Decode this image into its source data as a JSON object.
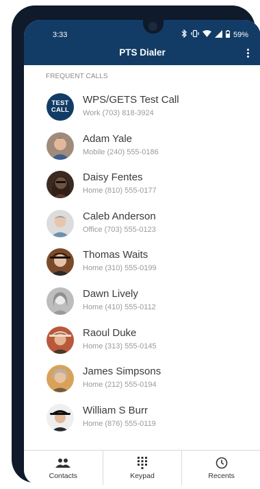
{
  "status_bar": {
    "time": "3:33",
    "battery": "59%"
  },
  "app": {
    "title": "PTS Dialer"
  },
  "section": {
    "header": "FREQUENT CALLS"
  },
  "contacts": [
    {
      "name": "WPS/GETS Test Call",
      "detail": "Work (703) 818-3924",
      "avatar_text_1": "TEST",
      "avatar_text_2": "CALL"
    },
    {
      "name": "Adam Yale",
      "detail": "Mobile (240) 555-0186"
    },
    {
      "name": "Daisy Fentes",
      "detail": "Home (810) 555-0177"
    },
    {
      "name": "Caleb Anderson",
      "detail": "Office (703) 555-0123"
    },
    {
      "name": "Thomas Waits",
      "detail": "Home (310) 555-0199"
    },
    {
      "name": "Dawn Lively",
      "detail": "Home (410) 555-0112"
    },
    {
      "name": "Raoul Duke",
      "detail": "Home (313) 555-0145"
    },
    {
      "name": "James Simpsons",
      "detail": "Home (212) 555-0194"
    },
    {
      "name": "William S Burr",
      "detail": "Home (876) 555-0119"
    }
  ],
  "bottom_nav": {
    "contacts_label": "Contacts",
    "keypad_label": "Keypad",
    "recents_label": "Recents"
  },
  "colors": {
    "app_bar": "#123c66",
    "frame": "#0f1a2b"
  }
}
